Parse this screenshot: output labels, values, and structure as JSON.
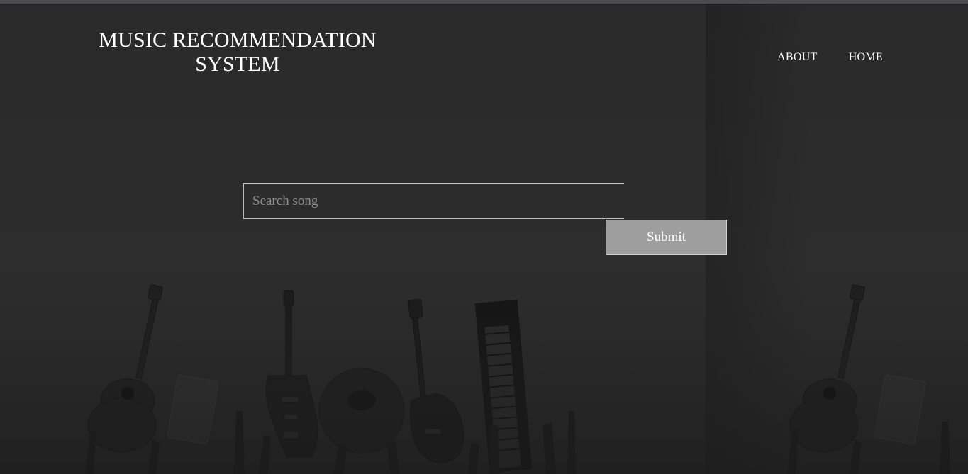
{
  "header": {
    "title_line1": "MUSIC RECOMMENDATION",
    "title_line2": "SYSTEM"
  },
  "nav": {
    "items": [
      {
        "label": "ABOUT"
      },
      {
        "label": "HOME"
      }
    ]
  },
  "search": {
    "placeholder": "Search song",
    "value": ""
  },
  "submit": {
    "label": "Submit"
  },
  "background": {
    "description_icon": "instruments-crowd-image",
    "colors": {
      "page": "#2b2b2b",
      "button": "#9f9e9f",
      "text": "#ffffff"
    }
  }
}
